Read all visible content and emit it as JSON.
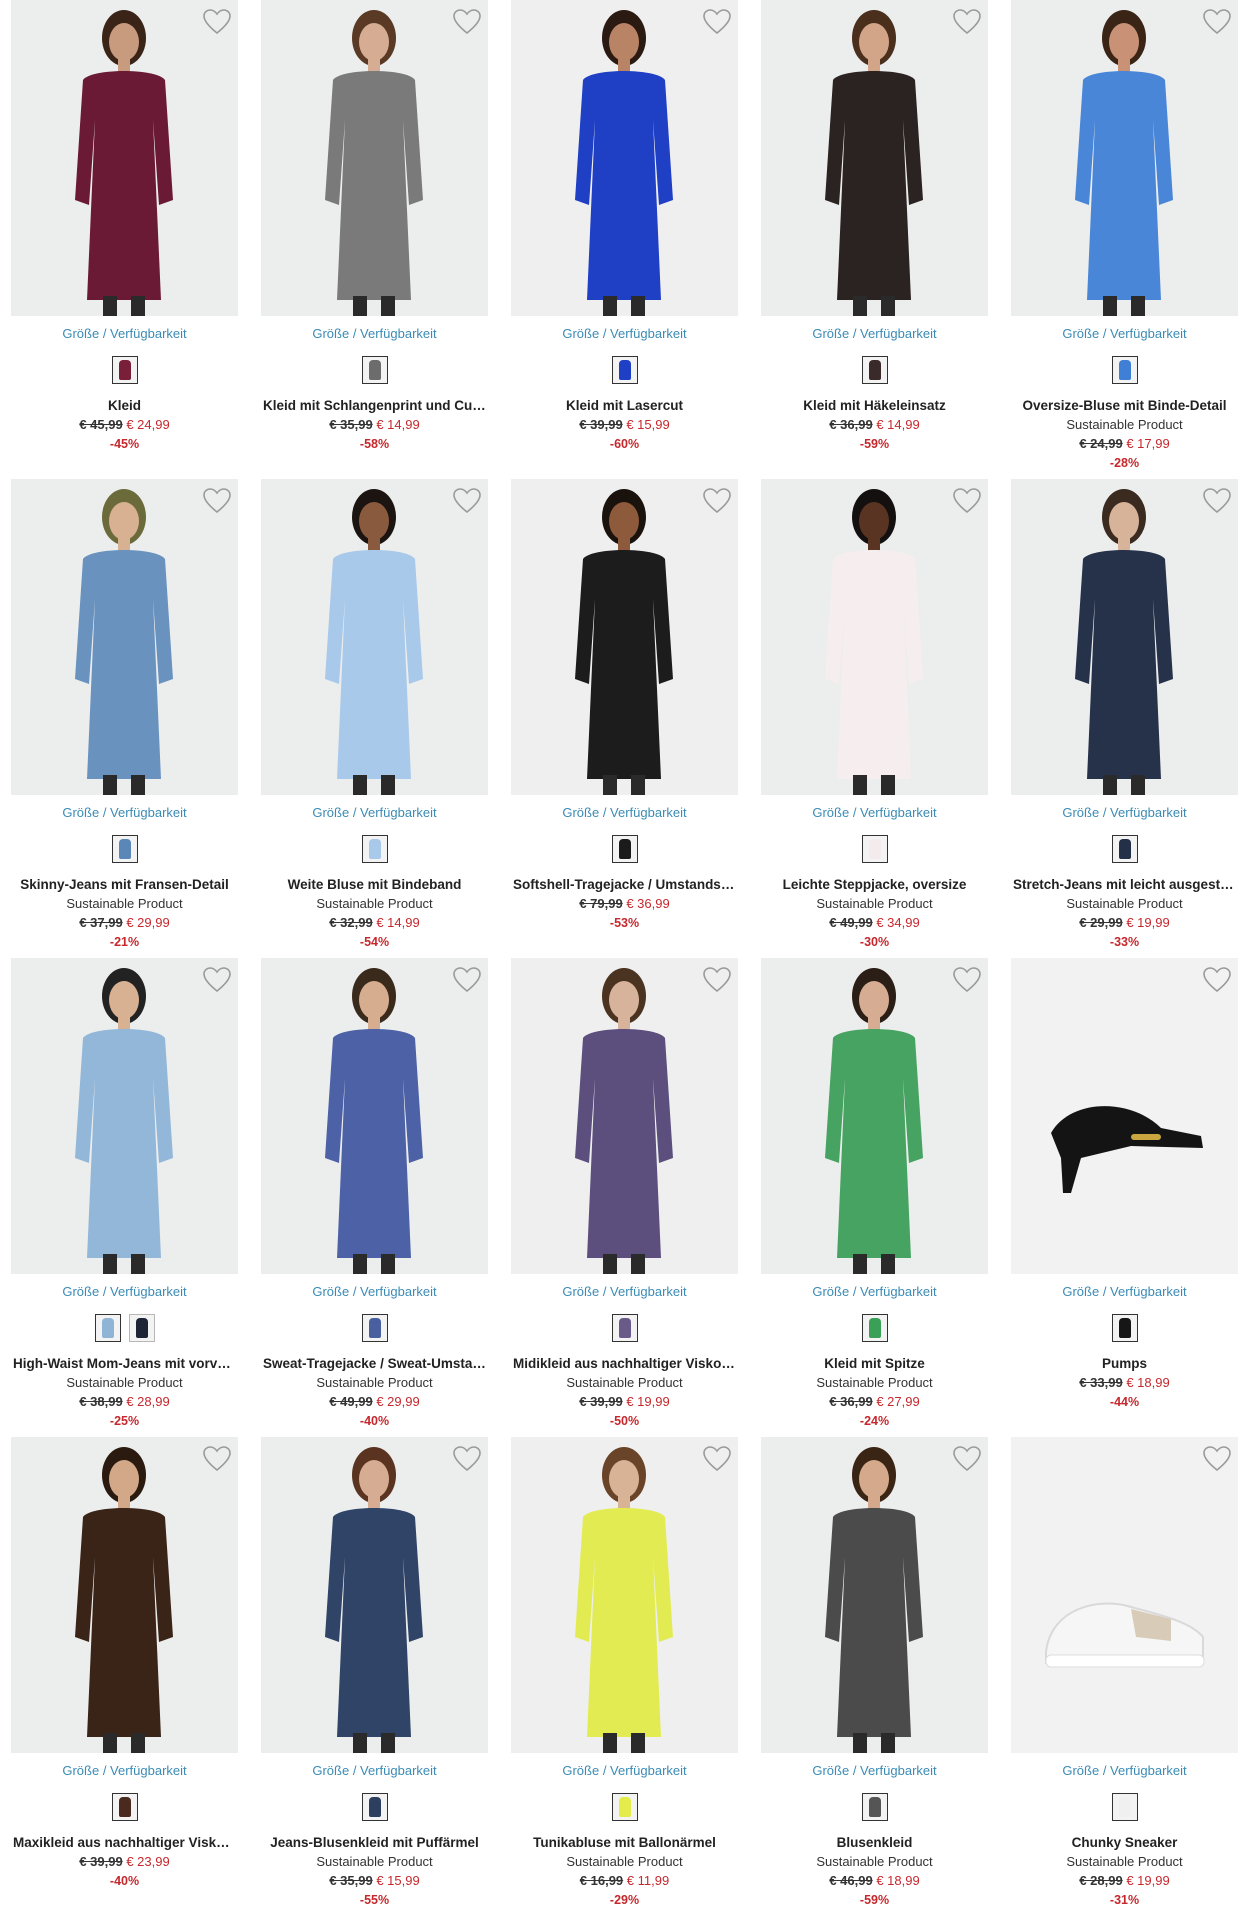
{
  "size_link": "Größe / Verfügbarkeit",
  "products": [
    {
      "name": "Kleid",
      "sustainable": "",
      "old": "€ 45,99",
      "new": "€ 24,99",
      "discount": "-45%",
      "swatches": [
        "#7a1f3a"
      ],
      "colors": {
        "bg": "#eceded",
        "main": "#6a1a35",
        "skin": "#c89a7e",
        "hair": "#3a2418"
      }
    },
    {
      "name": "Kleid mit Schlangenprint und Cut-Out",
      "sustainable": "",
      "old": "€ 35,99",
      "new": "€ 14,99",
      "discount": "-58%",
      "swatches": [
        "#6c6c6c"
      ],
      "colors": {
        "bg": "#eceded",
        "main": "#7a7a7a",
        "skin": "#d6ad92",
        "hair": "#5a3a24"
      }
    },
    {
      "name": "Kleid mit Lasercut",
      "sustainable": "",
      "old": "€ 39,99",
      "new": "€ 15,99",
      "discount": "-60%",
      "swatches": [
        "#1f3fc4"
      ],
      "colors": {
        "bg": "#efefef",
        "main": "#1f3fc4",
        "skin": "#b98466",
        "hair": "#2a1a12"
      }
    },
    {
      "name": "Kleid mit Häkeleinsatz",
      "sustainable": "",
      "old": "€ 36,99",
      "new": "€ 14,99",
      "discount": "-59%",
      "swatches": [
        "#3b2a2a"
      ],
      "colors": {
        "bg": "#eceded",
        "main": "#2b2222",
        "skin": "#d3a588",
        "hair": "#4a2f1d"
      }
    },
    {
      "name": "Oversize-Bluse mit Binde-Detail",
      "sustainable": "Sustainable Product",
      "old": "€ 24,99",
      "new": "€ 17,99",
      "discount": "-28%",
      "swatches": [
        "#3f7fd6"
      ],
      "colors": {
        "bg": "#eceded",
        "main": "#4a86d8",
        "skin": "#c99276",
        "hair": "#3a2416"
      }
    },
    {
      "name": "Skinny-Jeans mit Fransen-Detail",
      "sustainable": "Sustainable Product",
      "old": "€ 37,99",
      "new": "€ 29,99",
      "discount": "-21%",
      "swatches": [
        "#5a86b8"
      ],
      "colors": {
        "bg": "#eceded",
        "main": "#6a92bf",
        "skin": "#d8b092",
        "hair": "#6a6a3a"
      }
    },
    {
      "name": "Weite Bluse mit Bindeband",
      "sustainable": "Sustainable Product",
      "old": "€ 32,99",
      "new": "€ 14,99",
      "discount": "-54%",
      "swatches": [
        "#a9c9ea"
      ],
      "colors": {
        "bg": "#eceded",
        "main": "#a9c9ea",
        "skin": "#8a5a3e",
        "hair": "#1c1410"
      }
    },
    {
      "name": "Softshell-Tragejacke / Umstandsjacke",
      "sustainable": "",
      "old": "€ 79,99",
      "new": "€ 36,99",
      "discount": "-53%",
      "swatches": [
        "#1b1b1b"
      ],
      "colors": {
        "bg": "#efefef",
        "main": "#1c1c1c",
        "skin": "#8d5a3b",
        "hair": "#1a120c"
      }
    },
    {
      "name": "Leichte Steppjacke, oversize",
      "sustainable": "Sustainable Product",
      "old": "€ 49,99",
      "new": "€ 34,99",
      "discount": "-30%",
      "swatches": [
        "#f4ecec"
      ],
      "colors": {
        "bg": "#eceded",
        "main": "#f6eeee",
        "skin": "#5a3422",
        "hair": "#141010"
      }
    },
    {
      "name": "Stretch-Jeans mit leicht ausgestell…",
      "sustainable": "Sustainable Product",
      "old": "€ 29,99",
      "new": "€ 19,99",
      "discount": "-33%",
      "swatches": [
        "#233048"
      ],
      "colors": {
        "bg": "#eceded",
        "main": "#26324a",
        "skin": "#d7b39a",
        "hair": "#3a2a20"
      }
    },
    {
      "name": "High-Waist Mom-Jeans mit vorverle…",
      "sustainable": "Sustainable Product",
      "old": "€ 38,99",
      "new": "€ 28,99",
      "discount": "-25%",
      "swatches": [
        "#8fb4d6",
        "#1d2436"
      ],
      "colors": {
        "bg": "#eceded",
        "main": "#93b7d8",
        "skin": "#d8b092",
        "hair": "#222"
      }
    },
    {
      "name": "Sweat-Tragejacke / Sweat-Umstand…",
      "sustainable": "Sustainable Product",
      "old": "€ 49,99",
      "new": "€ 29,99",
      "discount": "-40%",
      "swatches": [
        "#4a5fa0"
      ],
      "colors": {
        "bg": "#eceded",
        "main": "#4d62a6",
        "skin": "#d7ad90",
        "hair": "#3a2a1c"
      }
    },
    {
      "name": "Midikleid aus nachhaltiger Viskose",
      "sustainable": "Sustainable Product",
      "old": "€ 39,99",
      "new": "€ 19,99",
      "discount": "-50%",
      "swatches": [
        "#6a5a8a"
      ],
      "colors": {
        "bg": "#efefef",
        "main": "#5c4f7e",
        "skin": "#d8b39c",
        "hair": "#4a3320"
      }
    },
    {
      "name": "Kleid mit Spitze",
      "sustainable": "Sustainable Product",
      "old": "€ 36,99",
      "new": "€ 27,99",
      "discount": "-24%",
      "swatches": [
        "#3aa058"
      ],
      "colors": {
        "bg": "#eceded",
        "main": "#47a361",
        "skin": "#d6ad92",
        "hair": "#2a1e16"
      }
    },
    {
      "name": "Pumps",
      "sustainable": "",
      "old": "€ 33,99",
      "new": "€ 18,99",
      "discount": "-44%",
      "swatches": [
        "#161616"
      ],
      "colors": {
        "bg": "#f2f2f2",
        "main": "#141414",
        "skin": "",
        "hair": ""
      }
    },
    {
      "name": "Maxikleid aus nachhaltiger Viskose",
      "sustainable": "",
      "old": "€ 39,99",
      "new": "€ 23,99",
      "discount": "-40%",
      "swatches": [
        "#4a2a1e"
      ],
      "colors": {
        "bg": "#eceded",
        "main": "#3a2418",
        "skin": "#d3a888",
        "hair": "#2a1a10"
      }
    },
    {
      "name": "Jeans-Blusenkleid mit Puffärmel",
      "sustainable": "Sustainable Product",
      "old": "€ 35,99",
      "new": "€ 15,99",
      "discount": "-55%",
      "swatches": [
        "#2c3f5e"
      ],
      "colors": {
        "bg": "#eceded",
        "main": "#2f4466",
        "skin": "#d6ad92",
        "hair": "#5a3420"
      }
    },
    {
      "name": "Tunikabluse mit Ballonärmel",
      "sustainable": "Sustainable Product",
      "old": "€ 16,99",
      "new": "€ 11,99",
      "discount": "-29%",
      "swatches": [
        "#e3ec4a"
      ],
      "colors": {
        "bg": "#efefef",
        "main": "#e2ec52",
        "skin": "#d9b396",
        "hair": "#6a4428"
      }
    },
    {
      "name": "Blusenkleid",
      "sustainable": "Sustainable Product",
      "old": "€ 46,99",
      "new": "€ 18,99",
      "discount": "-59%",
      "swatches": [
        "#555555"
      ],
      "colors": {
        "bg": "#eceded",
        "main": "#4b4b4b",
        "skin": "#d4a98c",
        "hair": "#3a2414"
      }
    },
    {
      "name": "Chunky Sneaker",
      "sustainable": "Sustainable Product",
      "old": "€ 28,99",
      "new": "€ 19,99",
      "discount": "-31%",
      "swatches": [
        "#f0f0f0"
      ],
      "colors": {
        "bg": "#f2f2f2",
        "main": "#f6f6f6",
        "skin": "",
        "hair": ""
      }
    }
  ]
}
